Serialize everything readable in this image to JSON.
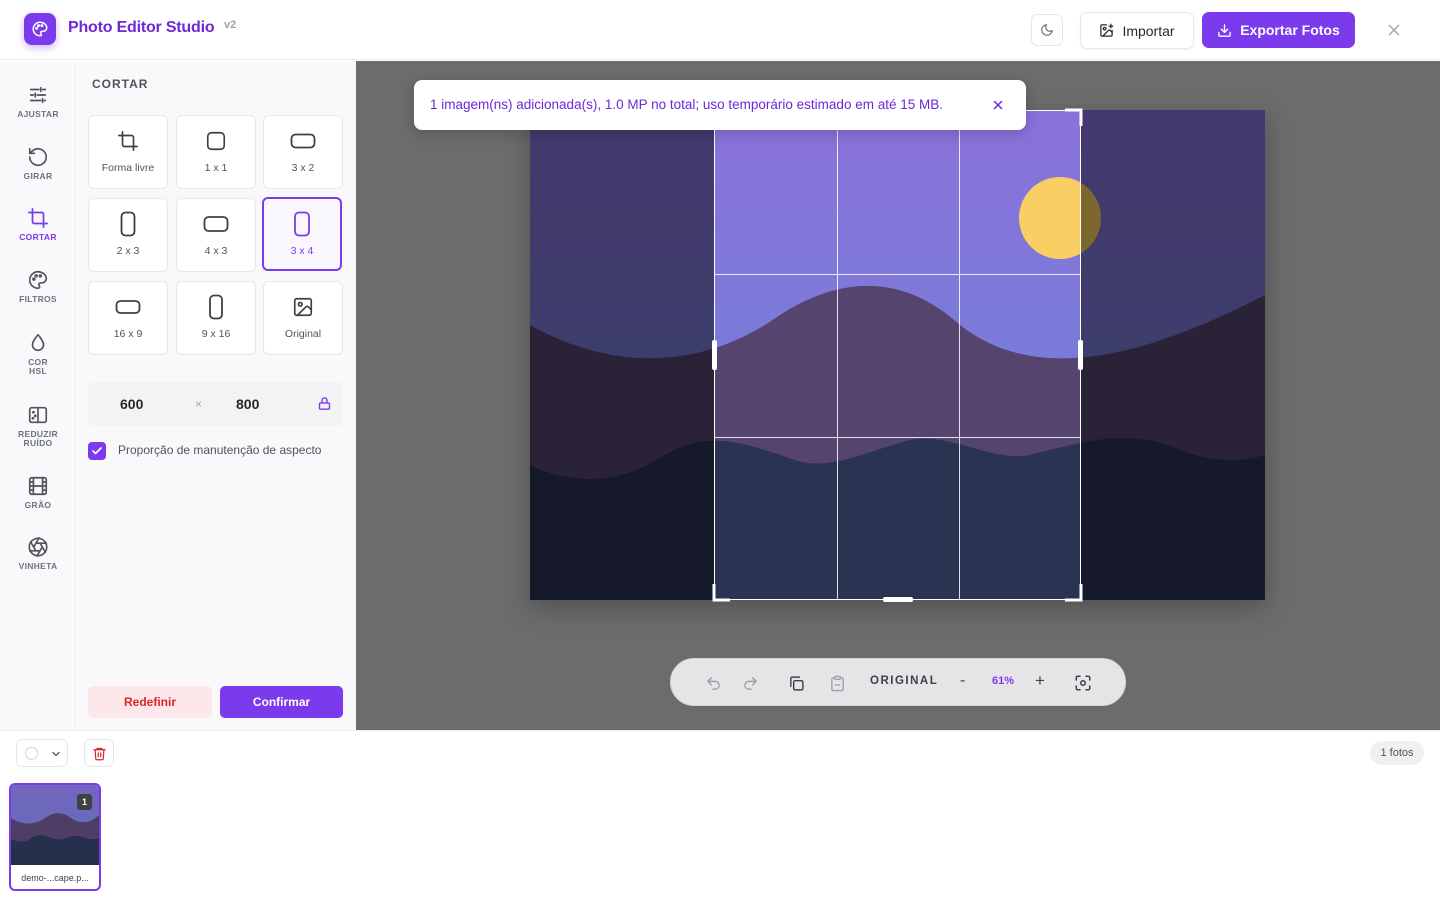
{
  "app": {
    "title": "Photo Editor Studio",
    "version": "v2"
  },
  "header": {
    "import_label": "Importar",
    "export_label": "Exportar Fotos"
  },
  "rail": [
    {
      "icon": "sliders-icon",
      "label": "AJUSTAR"
    },
    {
      "icon": "rotate-icon",
      "label": "GIRAR"
    },
    {
      "icon": "crop-icon",
      "label": "CORTAR",
      "active": true
    },
    {
      "icon": "palette-icon",
      "label": "FILTROS"
    },
    {
      "icon": "droplet-icon",
      "label": "COR HSL"
    },
    {
      "icon": "denoise-icon",
      "label": "REDUZIR RUÍDO"
    },
    {
      "icon": "film-icon",
      "label": "GRÃO"
    },
    {
      "icon": "aperture-icon",
      "label": "VINHETA"
    }
  ],
  "rail_labels": {
    "ajustar": "AJUSTAR",
    "girar": "GIRAR",
    "cortar": "CORTAR",
    "filtros": "FILTROS",
    "cor": "COR",
    "hsl": "HSL",
    "reduzir": "REDUZIR",
    "ruido": "RUÍDO",
    "grao": "GRÃO",
    "vinheta": "VINHETA"
  },
  "panel": {
    "title": "CORTAR",
    "ratios": [
      "Forma livre",
      "1 x 1",
      "3 x 2",
      "2 x 3",
      "4 x 3",
      "3 x 4",
      "16 x 9",
      "9 x 16",
      "Original"
    ],
    "selected_ratio": "3 x 4",
    "width": "600",
    "height": "800",
    "times": "×",
    "keep_aspect_label": "Proporção de manutenção de aspecto",
    "keep_aspect_checked": true,
    "reset_label": "Redefinir",
    "confirm_label": "Confirmar"
  },
  "toast": {
    "message": "1 imagem(ns) adicionada(s), 1.0 MP no total; uso temporário estimado em até 15 MB."
  },
  "zoombar": {
    "original_label": "ORIGINAL",
    "minus": "-",
    "zoom": "61%",
    "plus": "+"
  },
  "strip": {
    "count_label": "1 fotos",
    "thumbnails": [
      {
        "number": "1",
        "name": "demo-...cape.p..."
      }
    ]
  },
  "colors": {
    "accent": "#7c3aed",
    "danger": "#dc2626",
    "canvas_bg": "#6c6c6c"
  }
}
